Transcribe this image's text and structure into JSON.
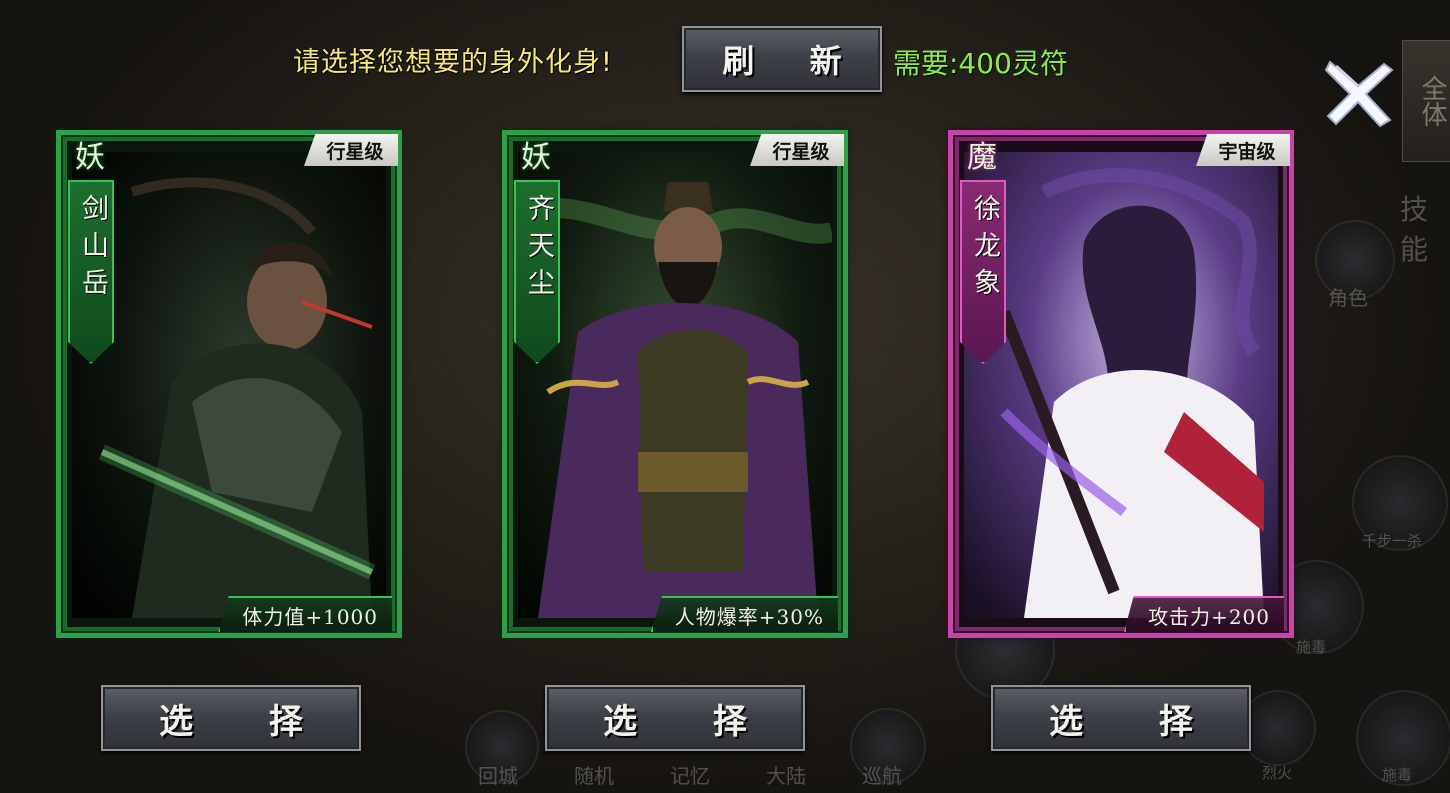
{
  "header": {
    "prompt": "请选择您想要的身外化身!",
    "refresh_label": "刷 新",
    "cost_label": "需要:400灵符"
  },
  "cards": [
    {
      "type_char": "妖",
      "grade": "行星级",
      "name": "剑山岳",
      "stat": "体力值+1000",
      "frame_color": "#2fa04a",
      "select_label": "选 择"
    },
    {
      "type_char": "妖",
      "grade": "行星级",
      "name": "齐天尘",
      "stat": "人物爆率+30%",
      "frame_color": "#2fa04a",
      "select_label": "选 择"
    },
    {
      "type_char": "魔",
      "grade": "宇宙级",
      "name": "徐龙象",
      "stat": "攻击力+200",
      "frame_color": "#c744a8",
      "select_label": "选 择"
    }
  ],
  "background_hud": {
    "right_panel": "全体",
    "skill_label": "技能",
    "role_label": "角色",
    "bottom_items": [
      "回城",
      "随机",
      "记忆",
      "大陆",
      "巡航"
    ],
    "right_items": [
      "千步一杀",
      "施毒",
      "烈火",
      "施毒"
    ]
  },
  "icons": {
    "close": "close-x-icon"
  }
}
